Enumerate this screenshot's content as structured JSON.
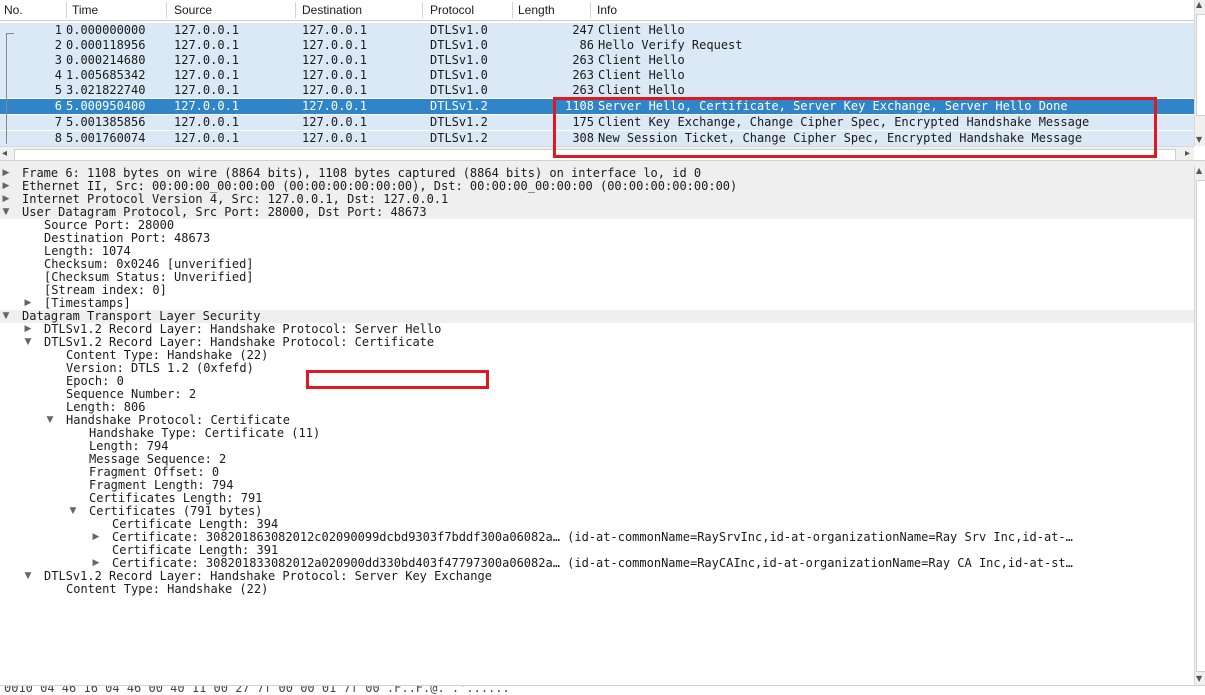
{
  "packet_list": {
    "columns": [
      "No.",
      "Time",
      "Source",
      "Destination",
      "Protocol",
      "Length",
      "Info"
    ],
    "rows": [
      {
        "no": "1",
        "time": "0.000000000",
        "src": "127.0.0.1",
        "dst": "127.0.0.1",
        "proto": "DTLSv1.0",
        "len": "247",
        "info": "Client Hello"
      },
      {
        "no": "2",
        "time": "0.000118956",
        "src": "127.0.0.1",
        "dst": "127.0.0.1",
        "proto": "DTLSv1.0",
        "len": "86",
        "info": "Hello Verify Request"
      },
      {
        "no": "3",
        "time": "0.000214680",
        "src": "127.0.0.1",
        "dst": "127.0.0.1",
        "proto": "DTLSv1.0",
        "len": "263",
        "info": "Client Hello"
      },
      {
        "no": "4",
        "time": "1.005685342",
        "src": "127.0.0.1",
        "dst": "127.0.0.1",
        "proto": "DTLSv1.0",
        "len": "263",
        "info": "Client Hello"
      },
      {
        "no": "5",
        "time": "3.021822740",
        "src": "127.0.0.1",
        "dst": "127.0.0.1",
        "proto": "DTLSv1.0",
        "len": "263",
        "info": "Client Hello"
      },
      {
        "no": "6",
        "time": "5.000950400",
        "src": "127.0.0.1",
        "dst": "127.0.0.1",
        "proto": "DTLSv1.2",
        "len": "1108",
        "info": "Server Hello, Certificate, Server Key Exchange, Server Hello Done"
      },
      {
        "no": "7",
        "time": "5.001385856",
        "src": "127.0.0.1",
        "dst": "127.0.0.1",
        "proto": "DTLSv1.2",
        "len": "175",
        "info": "Client Key Exchange, Change Cipher Spec, Encrypted Handshake Message"
      },
      {
        "no": "8",
        "time": "5.001760074",
        "src": "127.0.0.1",
        "dst": "127.0.0.1",
        "proto": "DTLSv1.2",
        "len": "308",
        "info": "New Session Ticket, Change Cipher Spec, Encrypted Handshake Message"
      }
    ],
    "selected_row": "6"
  },
  "details": {
    "lines": [
      {
        "t": "Frame 6: 1108 bytes on wire (8864 bits), 1108 bytes captured (8864 bits) on interface lo, id 0",
        "twisty": "collapsed"
      },
      {
        "t": "Ethernet II, Src: 00:00:00_00:00:00 (00:00:00:00:00:00), Dst: 00:00:00_00:00:00 (00:00:00:00:00:00)",
        "twisty": "collapsed"
      },
      {
        "t": "Internet Protocol Version 4, Src: 127.0.0.1, Dst: 127.0.0.1",
        "twisty": "collapsed"
      },
      {
        "t": "User Datagram Protocol, Src Port: 28000, Dst Port: 48673",
        "twisty": "expanded"
      },
      {
        "t": "Source Port: 28000",
        "twisty": "none"
      },
      {
        "t": "Destination Port: 48673",
        "twisty": "none"
      },
      {
        "t": "Length: 1074",
        "twisty": "none"
      },
      {
        "t": "Checksum: 0x0246 [unverified]",
        "twisty": "none"
      },
      {
        "t": "[Checksum Status: Unverified]",
        "twisty": "none"
      },
      {
        "t": "[Stream index: 0]",
        "twisty": "none"
      },
      {
        "t": "[Timestamps]",
        "twisty": "collapsed"
      },
      {
        "t": "Datagram Transport Layer Security",
        "twisty": "expanded"
      },
      {
        "t": "DTLSv1.2 Record Layer: Handshake Protocol: Server Hello",
        "twisty": "collapsed"
      },
      {
        "t": "DTLSv1.2 Record Layer: Handshake Protocol: Certificate",
        "twisty": "expanded"
      },
      {
        "t": "Content Type: Handshake (22)",
        "twisty": "none"
      },
      {
        "t": "Version: DTLS 1.2 (0xfefd)",
        "twisty": "none"
      },
      {
        "t": "Epoch: 0",
        "twisty": "none"
      },
      {
        "t": "Sequence Number: 2",
        "twisty": "none"
      },
      {
        "t": "Length: 806",
        "twisty": "none"
      },
      {
        "t": "Handshake Protocol: Certificate",
        "twisty": "expanded"
      },
      {
        "t": "Handshake Type: Certificate (11)",
        "twisty": "none"
      },
      {
        "t": "Length: 794",
        "twisty": "none"
      },
      {
        "t": "Message Sequence: 2",
        "twisty": "none"
      },
      {
        "t": "Fragment Offset: 0",
        "twisty": "none"
      },
      {
        "t": "Fragment Length: 794",
        "twisty": "none"
      },
      {
        "t": "Certificates Length: 791",
        "twisty": "none"
      },
      {
        "t": "Certificates (791 bytes)",
        "twisty": "expanded"
      },
      {
        "t": "Certificate Length: 394",
        "twisty": "none"
      },
      {
        "t": "Certificate: 308201863082012c02090099dcbd9303f7bddf300a06082a… (id-at-commonName=RaySrvInc,id-at-organizationName=Ray Srv Inc,id-at-…",
        "twisty": "collapsed"
      },
      {
        "t": "Certificate Length: 391",
        "twisty": "none"
      },
      {
        "t": "Certificate: 308201833082012a020900dd330bd403f47797300a06082a… (id-at-commonName=RayCAInc,id-at-organizationName=Ray CA Inc,id-at-st…",
        "twisty": "collapsed"
      },
      {
        "t": "DTLSv1.2 Record Layer: Handshake Protocol: Server Key Exchange",
        "twisty": "expanded"
      },
      {
        "t": "Content Type: Handshake (22)",
        "twisty": "none"
      }
    ]
  },
  "bytes_pane": {
    "text": "0010  04 46 16 04 46 00 40 11  00 27 7f 00 00 01 7f 00   .F..F.@. .'......"
  }
}
